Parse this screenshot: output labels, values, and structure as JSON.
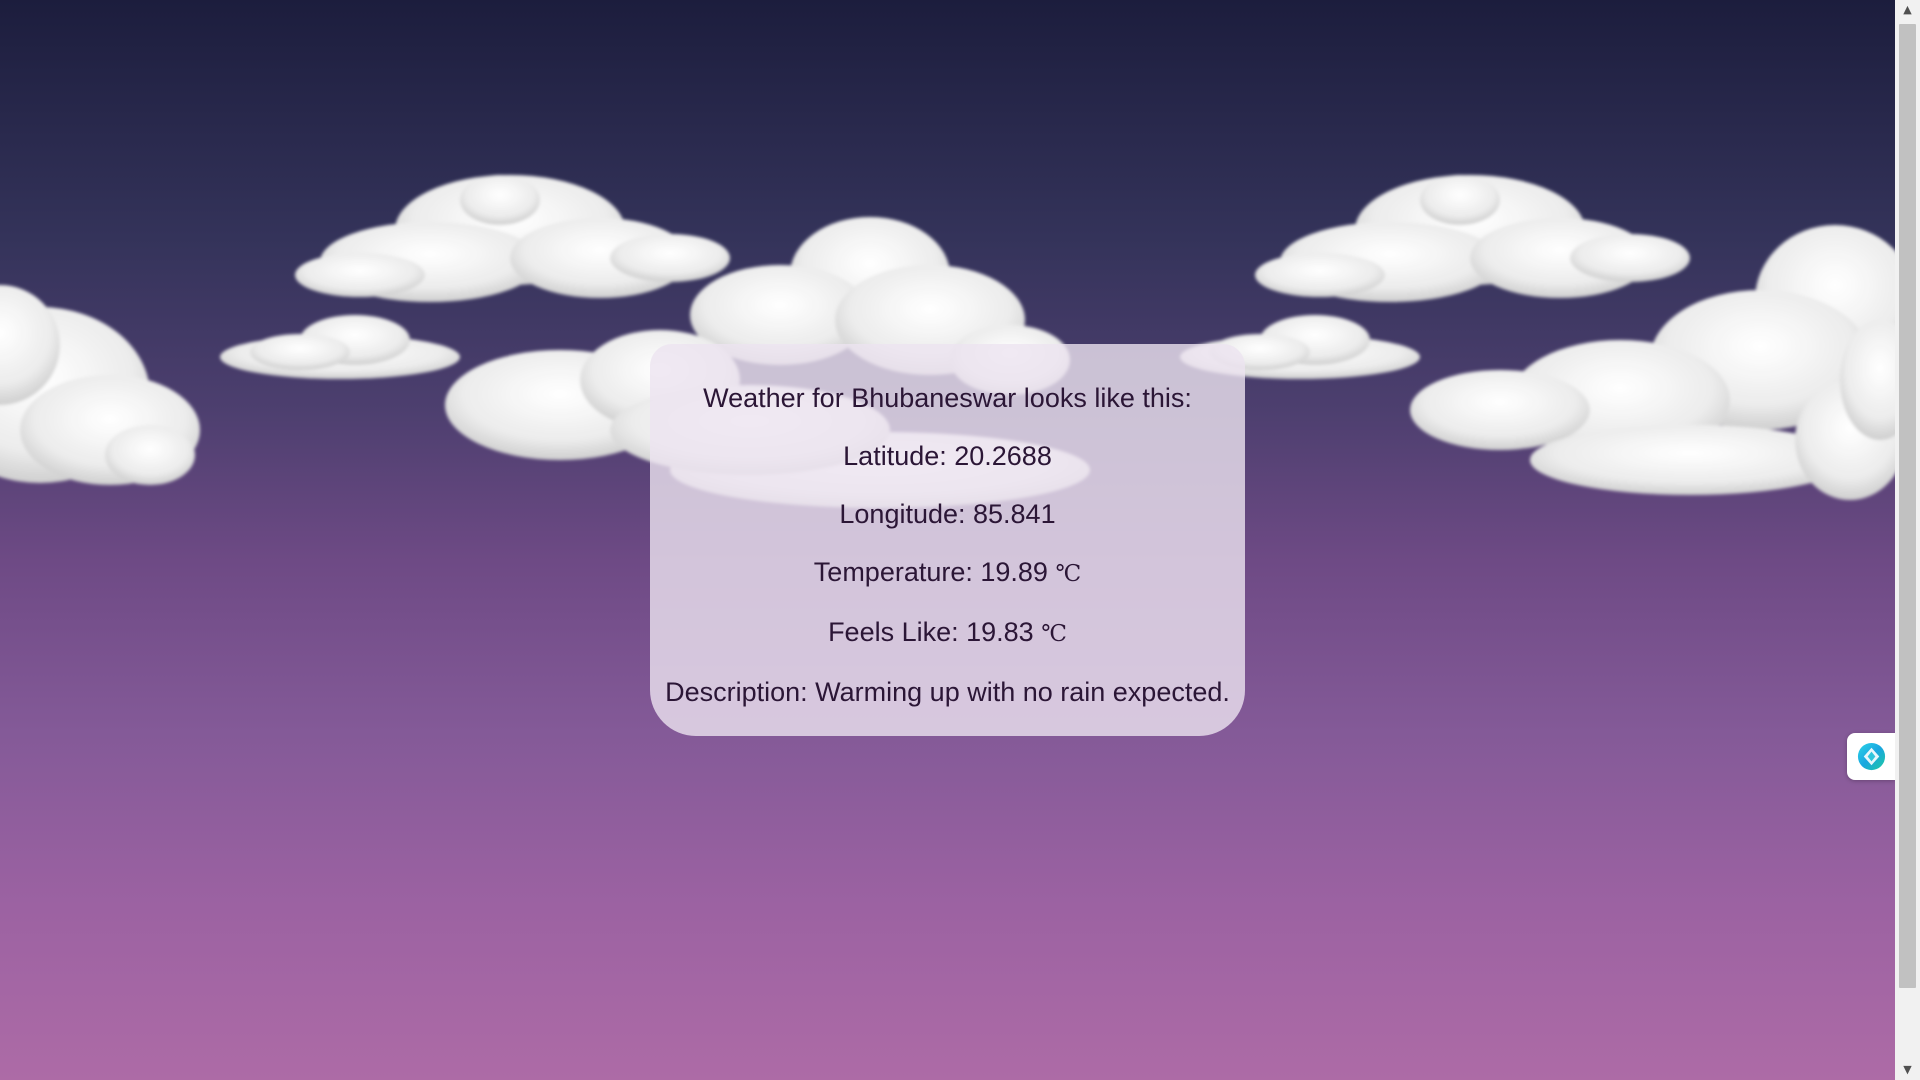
{
  "weather": {
    "heading": "Weather for Bhubaneswar looks like this:",
    "latitude": "Latitude: 20.2688",
    "longitude": "Longitude: 85.841",
    "temperature": "Temperature: 19.89",
    "temperature_unit": "℃",
    "feels_like": "Feels Like: 19.83",
    "feels_like_unit": "℃",
    "description": "Description: Warming up with no rain expected."
  },
  "colors": {
    "sky_top": "#1c1d3d",
    "sky_bottom": "#ad6ba6",
    "card_text": "#2b1636",
    "card_bg": "rgba(236,228,240,0.80)"
  },
  "icons": {
    "side_widget": "assistant-logo-icon",
    "scroll_up": "scroll-up-arrow-icon",
    "scroll_down": "scroll-down-arrow-icon"
  }
}
